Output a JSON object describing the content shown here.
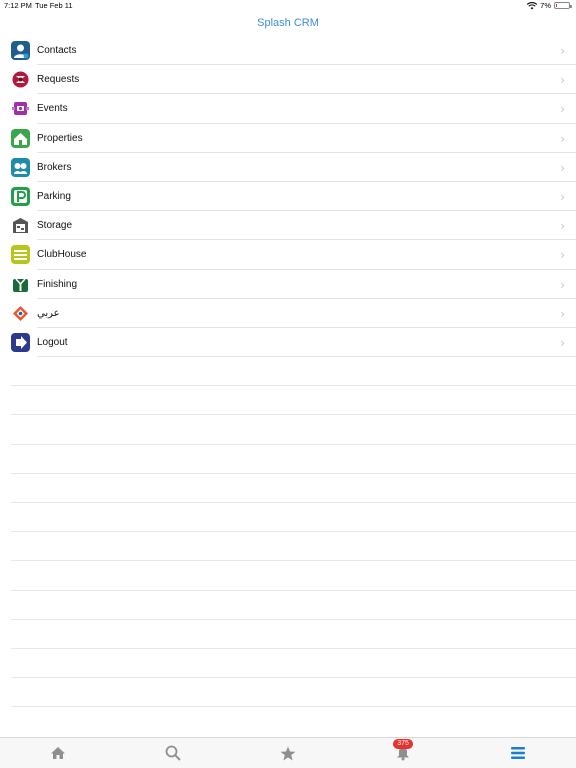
{
  "status_bar": {
    "time": "7:12 PM",
    "date": "Tue Feb 11",
    "battery": "7%",
    "battery_level": 0.07
  },
  "nav": {
    "title": "Splash CRM"
  },
  "menu": [
    {
      "label": "Contacts",
      "icon": "contacts-icon",
      "color": "#1f5e8c"
    },
    {
      "label": "Requests",
      "icon": "requests-icon",
      "color": "#b5163c"
    },
    {
      "label": "Events",
      "icon": "events-icon",
      "color": "#a02fa8"
    },
    {
      "label": "Properties",
      "icon": "properties-icon",
      "color": "#3aa84a"
    },
    {
      "label": "Brokers",
      "icon": "brokers-icon",
      "color": "#1f8ca8"
    },
    {
      "label": "Parking",
      "icon": "parking-icon",
      "color": "#22a04a"
    },
    {
      "label": "Storage",
      "icon": "storage-icon",
      "color": "#555555"
    },
    {
      "label": "ClubHouse",
      "icon": "clubhouse-icon",
      "color": "#b8c51a"
    },
    {
      "label": "Finishing",
      "icon": "finishing-icon",
      "color": "#1b6b3a"
    },
    {
      "label": "عربي",
      "icon": "arabic-language-icon",
      "color": "#e8582a"
    },
    {
      "label": "Logout",
      "icon": "logout-icon",
      "color": "#2b3a8c"
    }
  ],
  "tab_bar": {
    "notifications_badge": "375",
    "active_color": "#1a7fd4",
    "inactive_color": "#8e8e93"
  }
}
